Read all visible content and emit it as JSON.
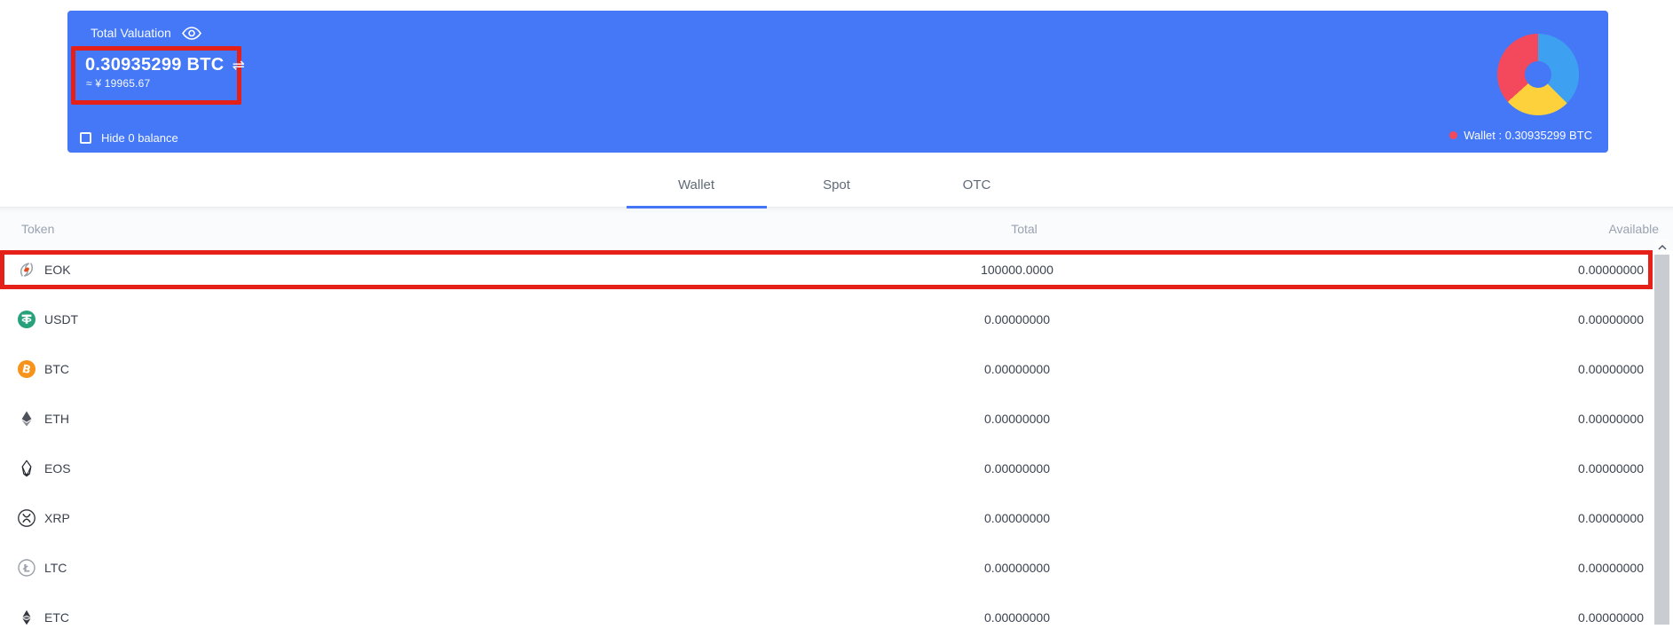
{
  "banner": {
    "title": "Total Valuation",
    "value": "0.30935299 BTC",
    "approx_value": "≈ ¥ 19965.67",
    "hide_zero_label": "Hide 0 balance",
    "hide_zero_checked": false,
    "legend_label": "Wallet : 0.30935299 BTC",
    "donut": {
      "type": "pie",
      "legend_position": "bottom-right",
      "segments": [
        {
          "name": "blue",
          "color": "#3da0f0",
          "deg": 135
        },
        {
          "name": "yellow",
          "color": "#fdd13c",
          "deg": 93
        },
        {
          "name": "red",
          "color": "#f4495c",
          "deg": 132
        }
      ]
    }
  },
  "tabs": [
    {
      "label": "Wallet",
      "active": true
    },
    {
      "label": "Spot",
      "active": false
    },
    {
      "label": "OTC",
      "active": false
    }
  ],
  "table": {
    "headers": {
      "token": "Token",
      "total": "Total",
      "available": "Available"
    },
    "rows": [
      {
        "token": "EOK",
        "icon": "eok",
        "total": "100000.0000",
        "available": "0.00000000",
        "highlighted": true
      },
      {
        "token": "USDT",
        "icon": "usdt",
        "total": "0.00000000",
        "available": "0.00000000",
        "highlighted": false
      },
      {
        "token": "BTC",
        "icon": "btc",
        "total": "0.00000000",
        "available": "0.00000000",
        "highlighted": false
      },
      {
        "token": "ETH",
        "icon": "eth",
        "total": "0.00000000",
        "available": "0.00000000",
        "highlighted": false
      },
      {
        "token": "EOS",
        "icon": "eos",
        "total": "0.00000000",
        "available": "0.00000000",
        "highlighted": false
      },
      {
        "token": "XRP",
        "icon": "xrp",
        "total": "0.00000000",
        "available": "0.00000000",
        "highlighted": false
      },
      {
        "token": "LTC",
        "icon": "ltc",
        "total": "0.00000000",
        "available": "0.00000000",
        "highlighted": false
      },
      {
        "token": "ETC",
        "icon": "etc",
        "total": "0.00000000",
        "available": "0.00000000",
        "highlighted": false
      }
    ]
  },
  "colors": {
    "banner": "#4478f7",
    "accent": "#4377f7",
    "annotation": "#e42018",
    "donut_red": "#f4495c",
    "donut_blue": "#3da0f0",
    "donut_yellow": "#fdd13c"
  }
}
